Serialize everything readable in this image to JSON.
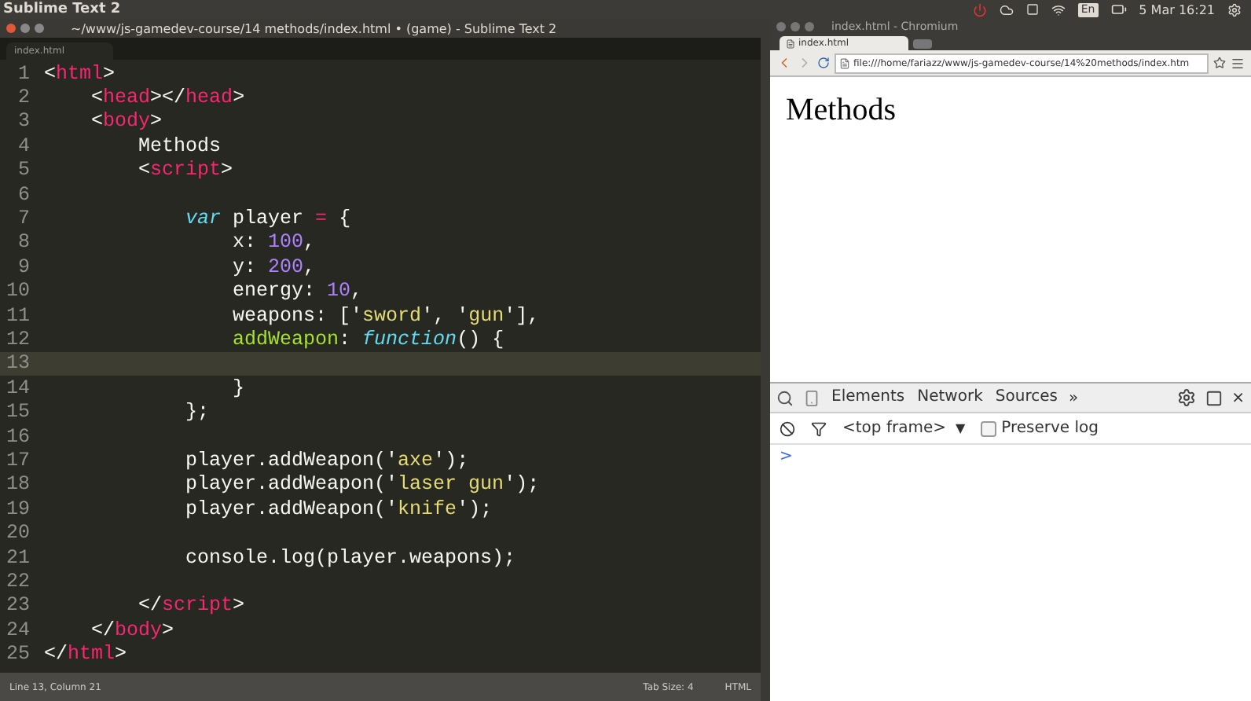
{
  "system_bar": {
    "app": "Sublime Text 2",
    "clock": "5 Mar 16:21",
    "keyboard": "En"
  },
  "editor": {
    "title": "~/www/js-gamedev-course/14 methods/index.html • (game) - Sublime Text 2",
    "tab": "index.html",
    "lines": [
      {
        "number": "1",
        "current": false,
        "tokens": [
          {
            "kind": "punct",
            "text": "<"
          },
          {
            "kind": "tag",
            "text": "html"
          },
          {
            "kind": "punct",
            "text": ">"
          }
        ]
      },
      {
        "number": "2",
        "current": false,
        "tokens": [
          {
            "kind": "punct",
            "text": "    <"
          },
          {
            "kind": "tag",
            "text": "head"
          },
          {
            "kind": "punct",
            "text": "></"
          },
          {
            "kind": "tag",
            "text": "head"
          },
          {
            "kind": "punct",
            "text": ">"
          }
        ]
      },
      {
        "number": "3",
        "current": false,
        "tokens": [
          {
            "kind": "punct",
            "text": "    <"
          },
          {
            "kind": "tag",
            "text": "body"
          },
          {
            "kind": "punct",
            "text": ">"
          }
        ]
      },
      {
        "number": "4",
        "current": false,
        "tokens": [
          {
            "kind": "punct",
            "text": "        Methods"
          }
        ]
      },
      {
        "number": "5",
        "current": false,
        "tokens": [
          {
            "kind": "punct",
            "text": "        <"
          },
          {
            "kind": "tag",
            "text": "script"
          },
          {
            "kind": "punct",
            "text": ">"
          }
        ]
      },
      {
        "number": "6",
        "current": false
      },
      {
        "number": "7",
        "current": false,
        "tokens": [
          {
            "kind": "keyword",
            "text": "            var"
          },
          {
            "kind": "punct",
            "text": " player "
          },
          {
            "kind": "tag",
            "text": "="
          },
          {
            "kind": "punct",
            "text": " {"
          }
        ]
      },
      {
        "number": "8",
        "current": false,
        "tokens": [
          {
            "kind": "punct",
            "text": "                x: "
          },
          {
            "kind": "number",
            "text": "100"
          },
          {
            "kind": "punct",
            "text": ","
          }
        ]
      },
      {
        "number": "9",
        "current": false,
        "tokens": [
          {
            "kind": "punct",
            "text": "                y: "
          },
          {
            "kind": "number",
            "text": "200"
          },
          {
            "kind": "punct",
            "text": ","
          }
        ]
      },
      {
        "number": "10",
        "current": false,
        "tokens": [
          {
            "kind": "punct",
            "text": "                energy: "
          },
          {
            "kind": "number",
            "text": "10"
          },
          {
            "kind": "punct",
            "text": ","
          }
        ]
      },
      {
        "number": "11",
        "current": false,
        "tokens": [
          {
            "kind": "punct",
            "text": "                weapons: ['"
          },
          {
            "kind": "string",
            "text": "sword"
          },
          {
            "kind": "punct",
            "text": "', '"
          },
          {
            "kind": "string",
            "text": "gun"
          },
          {
            "kind": "punct",
            "text": "'],"
          }
        ]
      },
      {
        "number": "12",
        "current": false,
        "tokens": [
          {
            "kind": "function",
            "text": "                addWeapon"
          },
          {
            "kind": "punct",
            "text": ": "
          },
          {
            "kind": "keyword",
            "text": "function"
          },
          {
            "kind": "punct",
            "text": "() {"
          }
        ]
      },
      {
        "number": "13",
        "current": true
      },
      {
        "number": "14",
        "current": false,
        "tokens": [
          {
            "kind": "punct",
            "text": "                }"
          }
        ]
      },
      {
        "number": "15",
        "current": false,
        "tokens": [
          {
            "kind": "punct",
            "text": "            };"
          }
        ]
      },
      {
        "number": "16",
        "current": false
      },
      {
        "number": "17",
        "current": false,
        "tokens": [
          {
            "kind": "punct",
            "text": "            player.addWeapon('"
          },
          {
            "kind": "string",
            "text": "axe"
          },
          {
            "kind": "punct",
            "text": "');"
          }
        ]
      },
      {
        "number": "18",
        "current": false,
        "tokens": [
          {
            "kind": "punct",
            "text": "            player.addWeapon('"
          },
          {
            "kind": "string",
            "text": "laser gun"
          },
          {
            "kind": "punct",
            "text": "');"
          }
        ]
      },
      {
        "number": "19",
        "current": false,
        "tokens": [
          {
            "kind": "punct",
            "text": "            player.addWeapon('"
          },
          {
            "kind": "string",
            "text": "knife"
          },
          {
            "kind": "punct",
            "text": "');"
          }
        ]
      },
      {
        "number": "20",
        "current": false
      },
      {
        "number": "21",
        "current": false,
        "tokens": [
          {
            "kind": "punct",
            "text": "            console.log(player.weapons);"
          }
        ]
      },
      {
        "number": "22",
        "current": false
      },
      {
        "number": "23",
        "current": false,
        "tokens": [
          {
            "kind": "punct",
            "text": "        </"
          },
          {
            "kind": "tag",
            "text": "script"
          },
          {
            "kind": "punct",
            "text": ">"
          }
        ]
      },
      {
        "number": "24",
        "current": false,
        "tokens": [
          {
            "kind": "punct",
            "text": "    </"
          },
          {
            "kind": "tag",
            "text": "body"
          },
          {
            "kind": "punct",
            "text": ">"
          }
        ]
      },
      {
        "number": "25",
        "current": false,
        "tokens": [
          {
            "kind": "punct",
            "text": "</"
          },
          {
            "kind": "tag",
            "text": "html"
          },
          {
            "kind": "punct",
            "text": ">"
          }
        ]
      }
    ],
    "status_bar": {
      "position": "Line 13, Column 21",
      "tab_size": "Tab Size: 4",
      "syntax": "HTML"
    }
  },
  "browser": {
    "title": "index.html - Chromium",
    "tab": "index.html",
    "address": "file:///home/fariazz/www/js-gamedev-course/14%20methods/index.htm",
    "heading": "Methods",
    "devtools": {
      "tabs": [
        {
          "label": "Elements",
          "selected": false
        },
        {
          "label": "Network",
          "selected": false
        },
        {
          "label": "Sources",
          "selected": false
        }
      ],
      "more": "»",
      "close": "×",
      "frame": "<top frame>",
      "frame_caret": "▼",
      "preserve_log": {
        "label": "Preserve log",
        "checked": false
      },
      "prompt": ">"
    }
  }
}
